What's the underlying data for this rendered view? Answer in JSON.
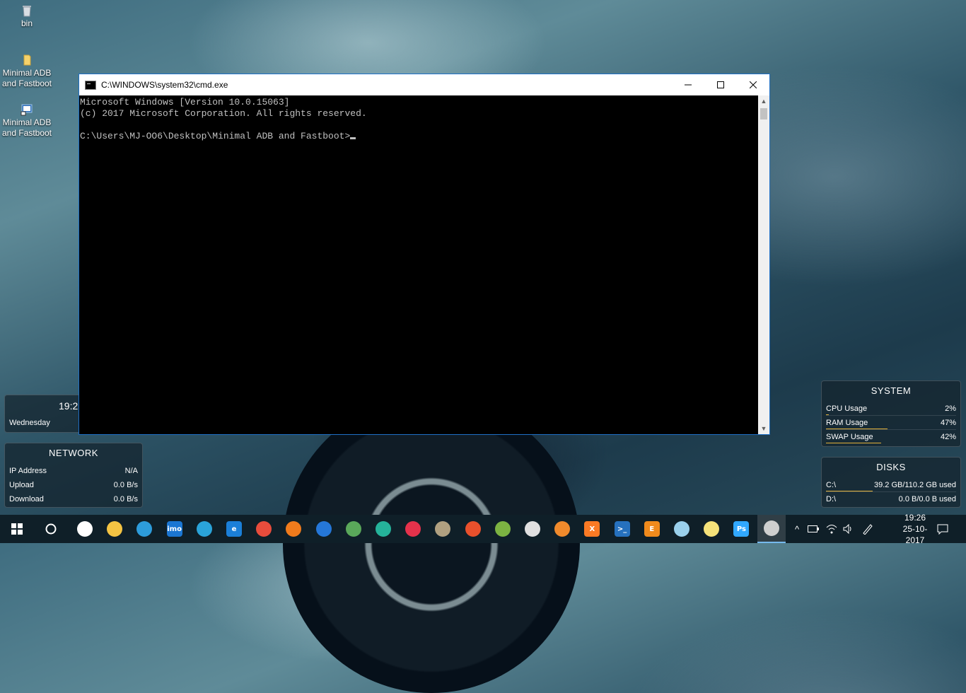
{
  "desktop": {
    "icons": [
      {
        "label": "bin"
      },
      {
        "label": "Minimal ADB and Fastboot"
      },
      {
        "label": "Minimal ADB and Fastboot"
      }
    ]
  },
  "cmd_window": {
    "title": "C:\\WINDOWS\\system32\\cmd.exe",
    "lines": [
      "Microsoft Windows [Version 10.0.15063]",
      "(c) 2017 Microsoft Corporation. All rights reserved.",
      "",
      "C:\\Users\\MJ-OO6\\Desktop\\Minimal ADB and Fastboot>"
    ]
  },
  "clock_widget": {
    "time": "19:2",
    "day": "Wednesday"
  },
  "network_widget": {
    "title": "NETWORK",
    "rows": [
      {
        "label": "IP Address",
        "value": "N/A"
      },
      {
        "label": "Upload",
        "value": "0.0 B/s"
      },
      {
        "label": "Download",
        "value": "0.0 B/s"
      }
    ]
  },
  "system_widget": {
    "title": "SYSTEM",
    "rows": [
      {
        "label": "CPU Usage",
        "value": "2%",
        "level": 0.02
      },
      {
        "label": "RAM Usage",
        "value": "47%",
        "level": 0.47
      },
      {
        "label": "SWAP Usage",
        "value": "42%",
        "level": 0.42
      }
    ]
  },
  "disks_widget": {
    "title": "DISKS",
    "rows": [
      {
        "label": "C:\\",
        "value": "39.2 GB/110.2 GB used",
        "level": 0.356
      },
      {
        "label": "D:\\",
        "value": "0.0 B/0.0 B used",
        "level": 0.0
      }
    ]
  },
  "taskbar": {
    "time": "19:26",
    "date": "25-10-2017",
    "apps": [
      {
        "name": "camera-icon",
        "text": "",
        "color": "#ffffff"
      },
      {
        "name": "file-explorer-icon",
        "text": "",
        "color": "#f4c443"
      },
      {
        "name": "sync-icon",
        "text": "",
        "color": "#2d9cdb"
      },
      {
        "name": "imo-icon",
        "text": "imo",
        "color": "#1b76d2"
      },
      {
        "name": "telegram-icon",
        "text": "",
        "color": "#2aa3d9"
      },
      {
        "name": "edge-icon",
        "text": "e",
        "color": "#1b7fd8"
      },
      {
        "name": "chrome-icon",
        "text": "",
        "color": "#e74c3c"
      },
      {
        "name": "firefox-icon",
        "text": "",
        "color": "#f07b1c"
      },
      {
        "name": "firefox-dev-icon",
        "text": "",
        "color": "#2577d8"
      },
      {
        "name": "globe-icon",
        "text": "",
        "color": "#5aa85a"
      },
      {
        "name": "cube-icon",
        "text": "",
        "color": "#25b39a"
      },
      {
        "name": "target-icon",
        "text": "",
        "color": "#e5324b"
      },
      {
        "name": "gimp-icon",
        "text": "",
        "color": "#b0a080"
      },
      {
        "name": "ccleaner-icon",
        "text": "",
        "color": "#e8502c"
      },
      {
        "name": "android-studio-icon",
        "text": "",
        "color": "#7cb342"
      },
      {
        "name": "unity-icon",
        "text": "",
        "color": "#e0e0e0"
      },
      {
        "name": "blender-icon",
        "text": "",
        "color": "#f08a2c"
      },
      {
        "name": "xampp-icon",
        "text": "X",
        "color": "#fb7a24"
      },
      {
        "name": "powershell-icon",
        "text": ">_",
        "color": "#2671be"
      },
      {
        "name": "e-app-icon",
        "text": "E",
        "color": "#f08a1c"
      },
      {
        "name": "notepad-icon",
        "text": "",
        "color": "#9ad0ec"
      },
      {
        "name": "sticky-notes-icon",
        "text": "",
        "color": "#f5e27a"
      },
      {
        "name": "photoshop-icon",
        "text": "Ps",
        "color": "#31a8ff"
      },
      {
        "name": "cmd-icon",
        "text": "",
        "color": "#cfcfcf"
      }
    ]
  }
}
